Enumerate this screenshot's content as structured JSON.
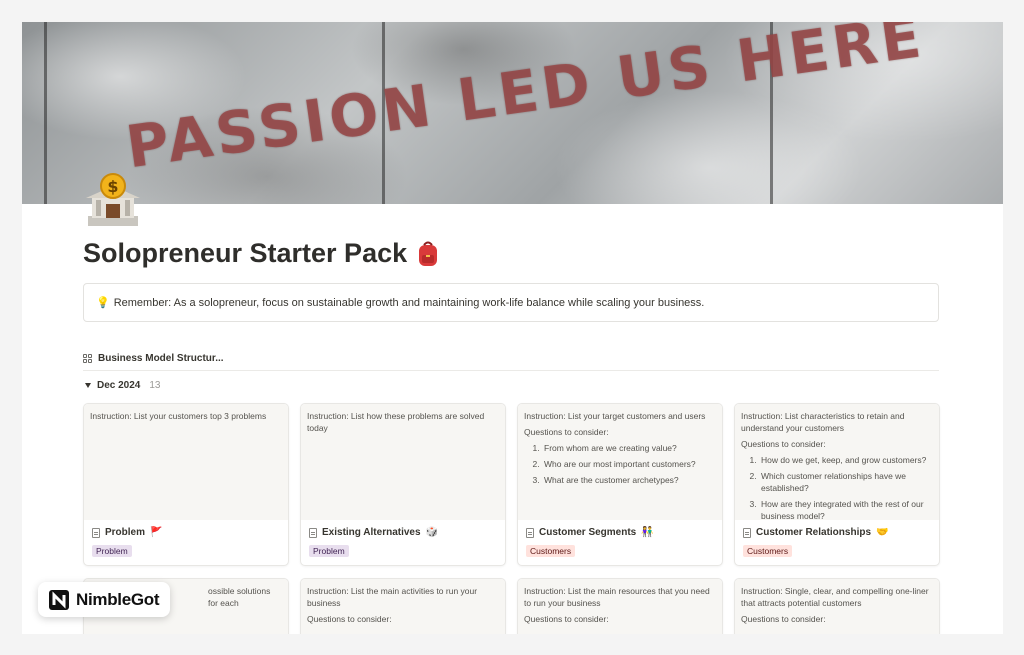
{
  "cover": {
    "text": "PASSION LED US HERE"
  },
  "page": {
    "icon": "bank-building-icon",
    "title": "Solopreneur Starter Pack",
    "title_emoji": "backpack-icon"
  },
  "callout": {
    "icon": "💡",
    "text": "Remember: As a solopreneur, focus on sustainable growth and maintaining work-life balance while scaling your business."
  },
  "view": {
    "label": "Business Model Structur..."
  },
  "group": {
    "name": "Dec 2024",
    "count": "13"
  },
  "cards": [
    {
      "instruction": "Instruction: List your customers top 3 problems",
      "title": "Problem",
      "emoji": "🚩",
      "tag": "Problem"
    },
    {
      "instruction": "Instruction: List how these problems are solved today",
      "title": "Existing Alternatives",
      "emoji": "🎲",
      "tag": "Problem"
    },
    {
      "instruction": "Instruction: List your target customers and users",
      "questions_label": "Questions to consider:",
      "questions": [
        "From whom are we creating value?",
        "Who are our most important customers?",
        "What are the customer archetypes?"
      ],
      "title": "Customer Segments",
      "emoji": "👫",
      "tag": "Customers"
    },
    {
      "instruction": "Instruction: List characteristics to retain and understand your customers",
      "questions_label": "Questions to consider:",
      "questions": [
        "How do we get, keep, and grow customers?",
        "Which customer relationships have we established?",
        "How are they integrated with the rest of our business model?"
      ],
      "title": "Customer Relationships",
      "emoji": "🤝",
      "tag": "Customers"
    }
  ],
  "cards_row2": [
    {
      "instruction": "ossible solutions for each"
    },
    {
      "instruction": "Instruction: List the main activities to run your business",
      "questions_label": "Questions to consider:"
    },
    {
      "instruction": "Instruction: List the main resources that you need to run your business",
      "questions_label": "Questions to consider:"
    },
    {
      "instruction": "Instruction: Single, clear, and compelling one-liner that attracts potential customers",
      "questions_label": "Questions to consider:"
    }
  ],
  "brand": {
    "name": "NimbleGot"
  }
}
